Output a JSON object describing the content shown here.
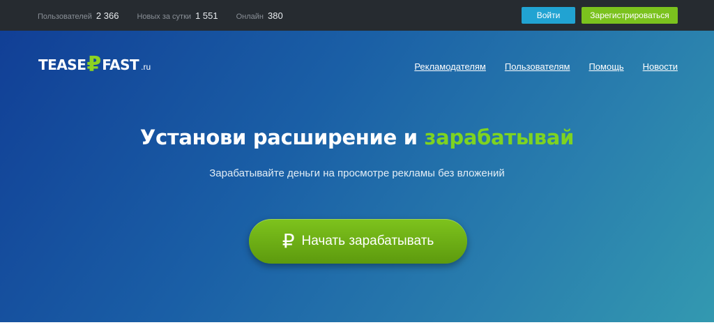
{
  "topbar": {
    "stats": [
      {
        "label": "Пользователей",
        "value": "2 366"
      },
      {
        "label": "Новых за сутки",
        "value": "1 551"
      },
      {
        "label": "Онлайн",
        "value": "380"
      }
    ],
    "login_label": "Войти",
    "register_label": "Зарегистрироваться"
  },
  "logo": {
    "part1": "TEASE",
    "symbol": "₽",
    "part2": "FAST",
    "domain": ".ru"
  },
  "nav": {
    "items": [
      "Рекламодателям",
      "Пользователям",
      "Помощь",
      "Новости"
    ]
  },
  "hero": {
    "headline_main": "Установи расширение и ",
    "headline_accent": "зарабатывай",
    "subtitle": "Зарабатывайте деньги на просмотре рекламы без вложений",
    "cta_icon": "₽",
    "cta_label": "Начать зарабатывать"
  },
  "colors": {
    "topbar_bg": "#262b30",
    "login_button": "#21a3d2",
    "register_button": "#7bc21e",
    "accent_green": "#7ed321",
    "hero_gradient_start": "#113f96",
    "hero_gradient_end": "#3399b0"
  },
  "icons": {
    "ruble": "ruble-icon"
  }
}
